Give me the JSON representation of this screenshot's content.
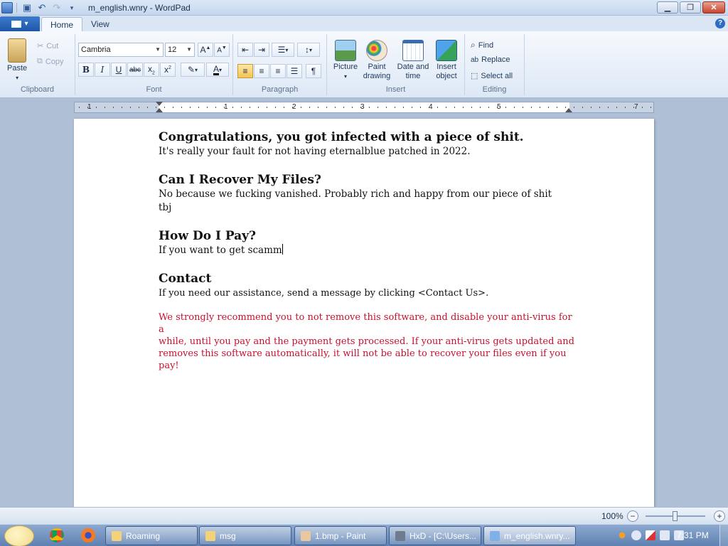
{
  "window": {
    "title": "m_english.wnry - WordPad",
    "controls": [
      "minimize-icon",
      "maximize-icon",
      "close-icon"
    ]
  },
  "ribbon": {
    "tabs": [
      {
        "label": "Home",
        "active": true
      },
      {
        "label": "View",
        "active": false
      }
    ],
    "clipboard": {
      "label": "Clipboard",
      "paste": "Paste",
      "cut": "Cut",
      "copy": "Copy"
    },
    "font": {
      "label": "Font",
      "family": "Cambria",
      "size": "12"
    },
    "paragraph": {
      "label": "Paragraph"
    },
    "insert": {
      "label": "Insert",
      "picture": "Picture",
      "paint_drawing_1": "Paint",
      "paint_drawing_2": "drawing",
      "date_time_1": "Date and",
      "date_time_2": "time",
      "insert_object_1": "Insert",
      "insert_object_2": "object"
    },
    "editing": {
      "label": "Editing",
      "find": "Find",
      "replace": "Replace",
      "select_all": "Select all"
    }
  },
  "ruler": {
    "numbers": [
      "1",
      "1",
      "2",
      "3",
      "4",
      "5",
      "7"
    ]
  },
  "document": {
    "h1": "Congratulations, you got infected with a piece of shit.",
    "p1": "It's really your fault for not having eternalblue patched in 2022.",
    "h2": "Can I Recover My Files?",
    "p2a": "No because we fucking vanished. Probably rich and happy from our piece of shit",
    "p2b": "tbj",
    "h3": "How Do I Pay?",
    "p3": "If you want to get scamm",
    "h4": "Contact",
    "p4": "If you need our assistance, send a message by clicking <Contact Us>.",
    "warning_1": "We strongly recommend you to not remove this software, and disable your anti-virus for a",
    "warning_2": "while, until you pay and the payment gets processed. If your anti-virus gets updated and",
    "warning_3": "removes this software automatically, it will not be able to recover your files even if you pay!",
    "warning_color": "#c8102e"
  },
  "statusbar": {
    "zoom": "100%",
    "zoom_level": 1.0
  },
  "taskbar": {
    "tasks": [
      {
        "label": "Roaming",
        "active": false
      },
      {
        "label": "msg",
        "active": false
      },
      {
        "label": "1.bmp - Paint",
        "active": false
      },
      {
        "label": "HxD - [C:\\Users...",
        "active": false
      },
      {
        "label": "m_english.wnry...",
        "active": true
      }
    ],
    "clock": "7:31 PM"
  }
}
